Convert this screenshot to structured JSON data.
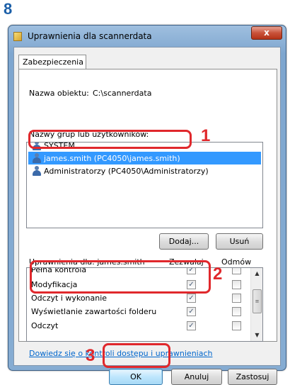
{
  "step_number": "8",
  "window": {
    "title": "Uprawnienia dla scannerdata",
    "close_label": "x"
  },
  "tab": {
    "label": "Zabezpieczenia"
  },
  "object_name": {
    "label": "Nazwa obiektu:",
    "value": "C:\\scannerdata"
  },
  "groups": {
    "label": "Nazwy grup lub użytkowników:",
    "items": [
      {
        "label": "SYSTEM",
        "icon": "group-icon"
      },
      {
        "label": "james.smith (PC4050\\james.smith)",
        "icon": "user-icon",
        "selected": true
      },
      {
        "label": "Administratorzy (PC4050\\Administratorzy)",
        "icon": "group-icon"
      }
    ]
  },
  "buttons": {
    "add": "Dodaj...",
    "remove": "Usuń",
    "ok": "OK",
    "cancel": "Anuluj",
    "apply": "Zastosuj"
  },
  "permissions": {
    "label": "Uprawnienia dla: james.smith",
    "allow_header": "Zezwalaj",
    "deny_header": "Odmów",
    "rows": [
      {
        "name": "Pełna kontrola",
        "allow": true,
        "deny": false
      },
      {
        "name": "Modyfikacja",
        "allow": true,
        "deny": false
      },
      {
        "name": "Odczyt i wykonanie",
        "allow": true,
        "deny": false
      },
      {
        "name": "Wyświetlanie zawartości folderu",
        "allow": true,
        "deny": false
      },
      {
        "name": "Odczyt",
        "allow": true,
        "deny": false
      }
    ]
  },
  "link": "Dowiedz się o kontroli dostępu i uprawnieniach",
  "callouts": [
    "1",
    "2",
    "3"
  ],
  "colors": {
    "callout": "#e0282c",
    "step": "#1b5fa8",
    "selection": "#3399ff"
  }
}
